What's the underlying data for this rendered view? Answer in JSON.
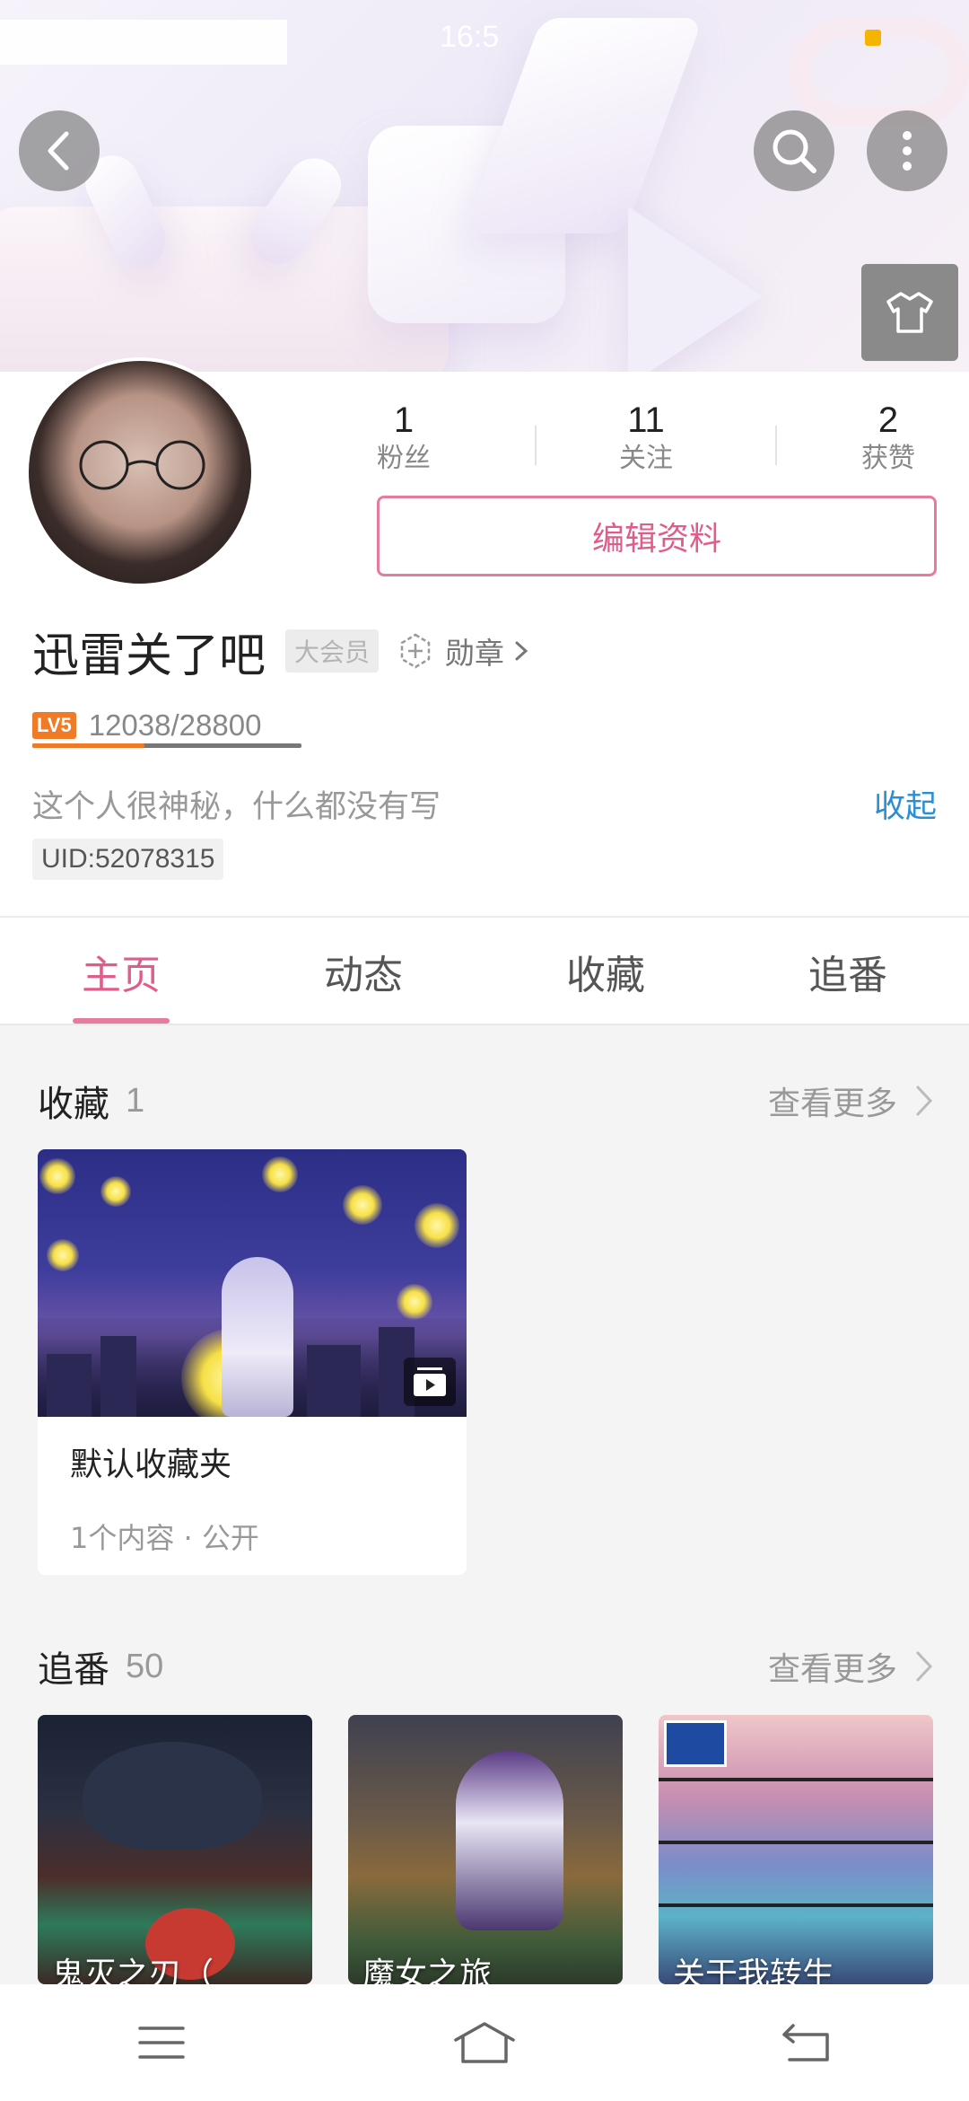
{
  "status_bar": {
    "time": "16:5",
    "indicator_color": "#f5b400"
  },
  "header": {
    "back_icon": "chevron-left-icon",
    "search_icon": "search-icon",
    "more_icon": "more-vertical-icon",
    "skin_icon": "tshirt-icon"
  },
  "profile": {
    "stats": [
      {
        "value": "1",
        "label": "粉丝"
      },
      {
        "value": "11",
        "label": "关注"
      },
      {
        "value": "2",
        "label": "获赞"
      }
    ],
    "edit_button": "编辑资料",
    "username": "迅雷关了吧",
    "vip_badge": "大会员",
    "medal_label": "勋章",
    "level_badge": "LV5",
    "exp_text": "12038/28800",
    "exp_fraction": 0.418,
    "bio": "这个人很神秘，什么都没有写",
    "collapse_label": "收起",
    "uid": "UID:52078315"
  },
  "tabs": [
    {
      "label": "主页",
      "active": true
    },
    {
      "label": "动态",
      "active": false
    },
    {
      "label": "收藏",
      "active": false
    },
    {
      "label": "追番",
      "active": false
    }
  ],
  "favorites": {
    "title": "收藏",
    "count": "1",
    "more_label": "查看更多",
    "folder": {
      "name": "默认收藏夹",
      "meta": "1个内容 · 公开"
    }
  },
  "bangumi": {
    "title": "追番",
    "count": "50",
    "more_label": "查看更多",
    "items": [
      {
        "title": "鬼灭之刃（"
      },
      {
        "title": "魔女之旅"
      },
      {
        "title": "关于我转生"
      }
    ]
  },
  "navbar": {
    "menu_icon": "menu-icon",
    "home_icon": "home-icon",
    "back_icon": "back-icon"
  },
  "colors": {
    "accent_pink": "#e05c8a",
    "link_blue": "#2a8ed4",
    "level_orange": "#f07b26"
  }
}
